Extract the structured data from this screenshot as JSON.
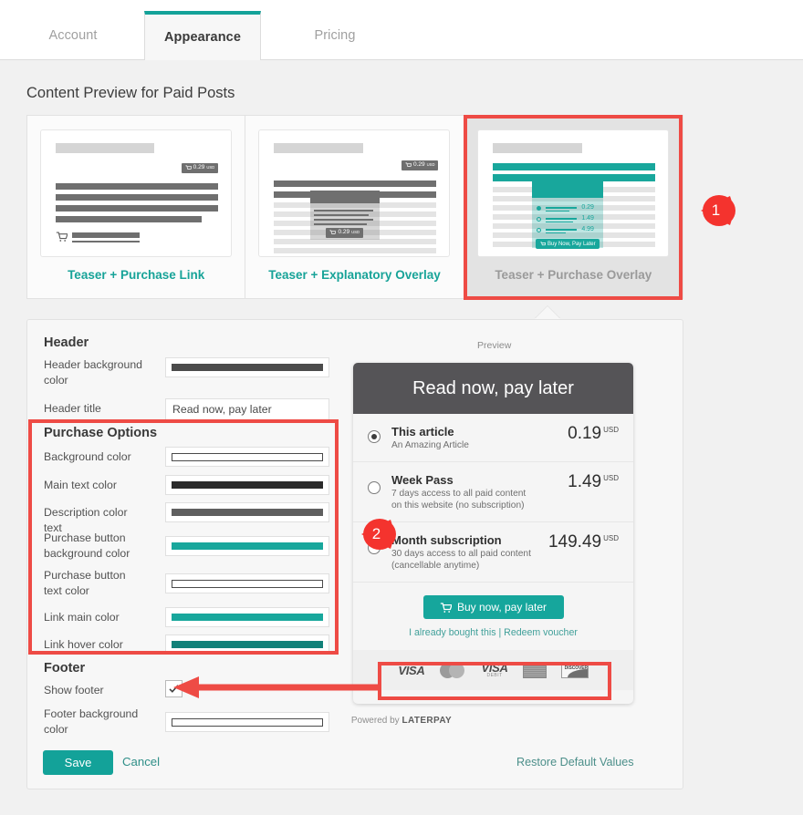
{
  "tabs": [
    {
      "label": "Account",
      "active": false
    },
    {
      "label": "Appearance",
      "active": true
    },
    {
      "label": "Pricing",
      "active": false
    }
  ],
  "page_title": "Content Preview for Paid Posts",
  "chooser": {
    "options": [
      {
        "label": "Teaser + Purchase Link",
        "selected": false,
        "price_chip": "0.29",
        "chip_sup": "USD"
      },
      {
        "label": "Teaser + Explanatory Overlay",
        "selected": false,
        "price_chip": "0.29",
        "chip_sup": "USD"
      },
      {
        "label": "Teaser + Purchase Overlay",
        "selected": true,
        "button_label": "Buy Now, Pay Later",
        "prices": [
          "0.29",
          "1.49",
          "4.99"
        ],
        "chip_sup": "USD"
      }
    ]
  },
  "form": {
    "header_section": "Header",
    "header_bg_label": "Header background color",
    "header_bg_color": "#4b4b4b",
    "header_title_label": "Header title",
    "header_title_value": "Read now, pay later",
    "purchase_section": "Purchase Options",
    "background_label": "Background color",
    "background_color": "#ffffff",
    "main_text_label": "Main text color",
    "main_text_color": "#2b2b2b",
    "description_label": "Description color text",
    "description_color": "#5f5f5f",
    "btn_bg_label": "Purchase button background color",
    "btn_bg_color": "#18a79c",
    "btn_text_label": "Purchase button text color",
    "btn_text_color": "#ffffff",
    "link_main_label": "Link main color",
    "link_main_color": "#18a79c",
    "link_hover_label": "Link hover color",
    "link_hover_color": "#128179",
    "footer_section": "Footer",
    "show_footer_label": "Show footer",
    "show_footer_checked": true,
    "footer_bg_label": "Footer background color",
    "footer_bg_color": "#ffffff",
    "save_label": "Save",
    "cancel_label": "Cancel",
    "restore_label": "Restore Default Values"
  },
  "preview": {
    "caption": "Preview",
    "header_title": "Read now, pay later",
    "options": [
      {
        "title": "This article",
        "desc": "An Amazing Article",
        "price": "0.19",
        "currency": "USD",
        "selected": true
      },
      {
        "title": "Week Pass",
        "desc": "7 days access to all paid content\non this website (no subscription)",
        "price": "1.49",
        "currency": "USD",
        "selected": false
      },
      {
        "title": "Month subscription",
        "desc": "30 days access to all paid content\n(cancellable anytime)",
        "price": "149.49",
        "currency": "USD",
        "selected": false
      }
    ],
    "buy_button": "Buy now, pay later",
    "secondary_links": "I already bought this | Redeem voucher",
    "payment_methods": [
      "VISA",
      "mastercard",
      "VISA DEBIT",
      "maestro",
      "DISCOVER"
    ],
    "powered_prefix": "Powered by ",
    "powered_brand": "LATERPAY"
  },
  "annotations": {
    "callouts": [
      {
        "number": "1",
        "target": "teaser-purchase-overlay-card"
      },
      {
        "number": "2",
        "target": "purchase-options-section"
      }
    ],
    "accent_color": "#ee4b45"
  },
  "colors": {
    "brand_teal": "#17a398",
    "annotation_red": "#ee4b45",
    "page_bg": "#f1f1f1",
    "header_dark": "#555457"
  }
}
